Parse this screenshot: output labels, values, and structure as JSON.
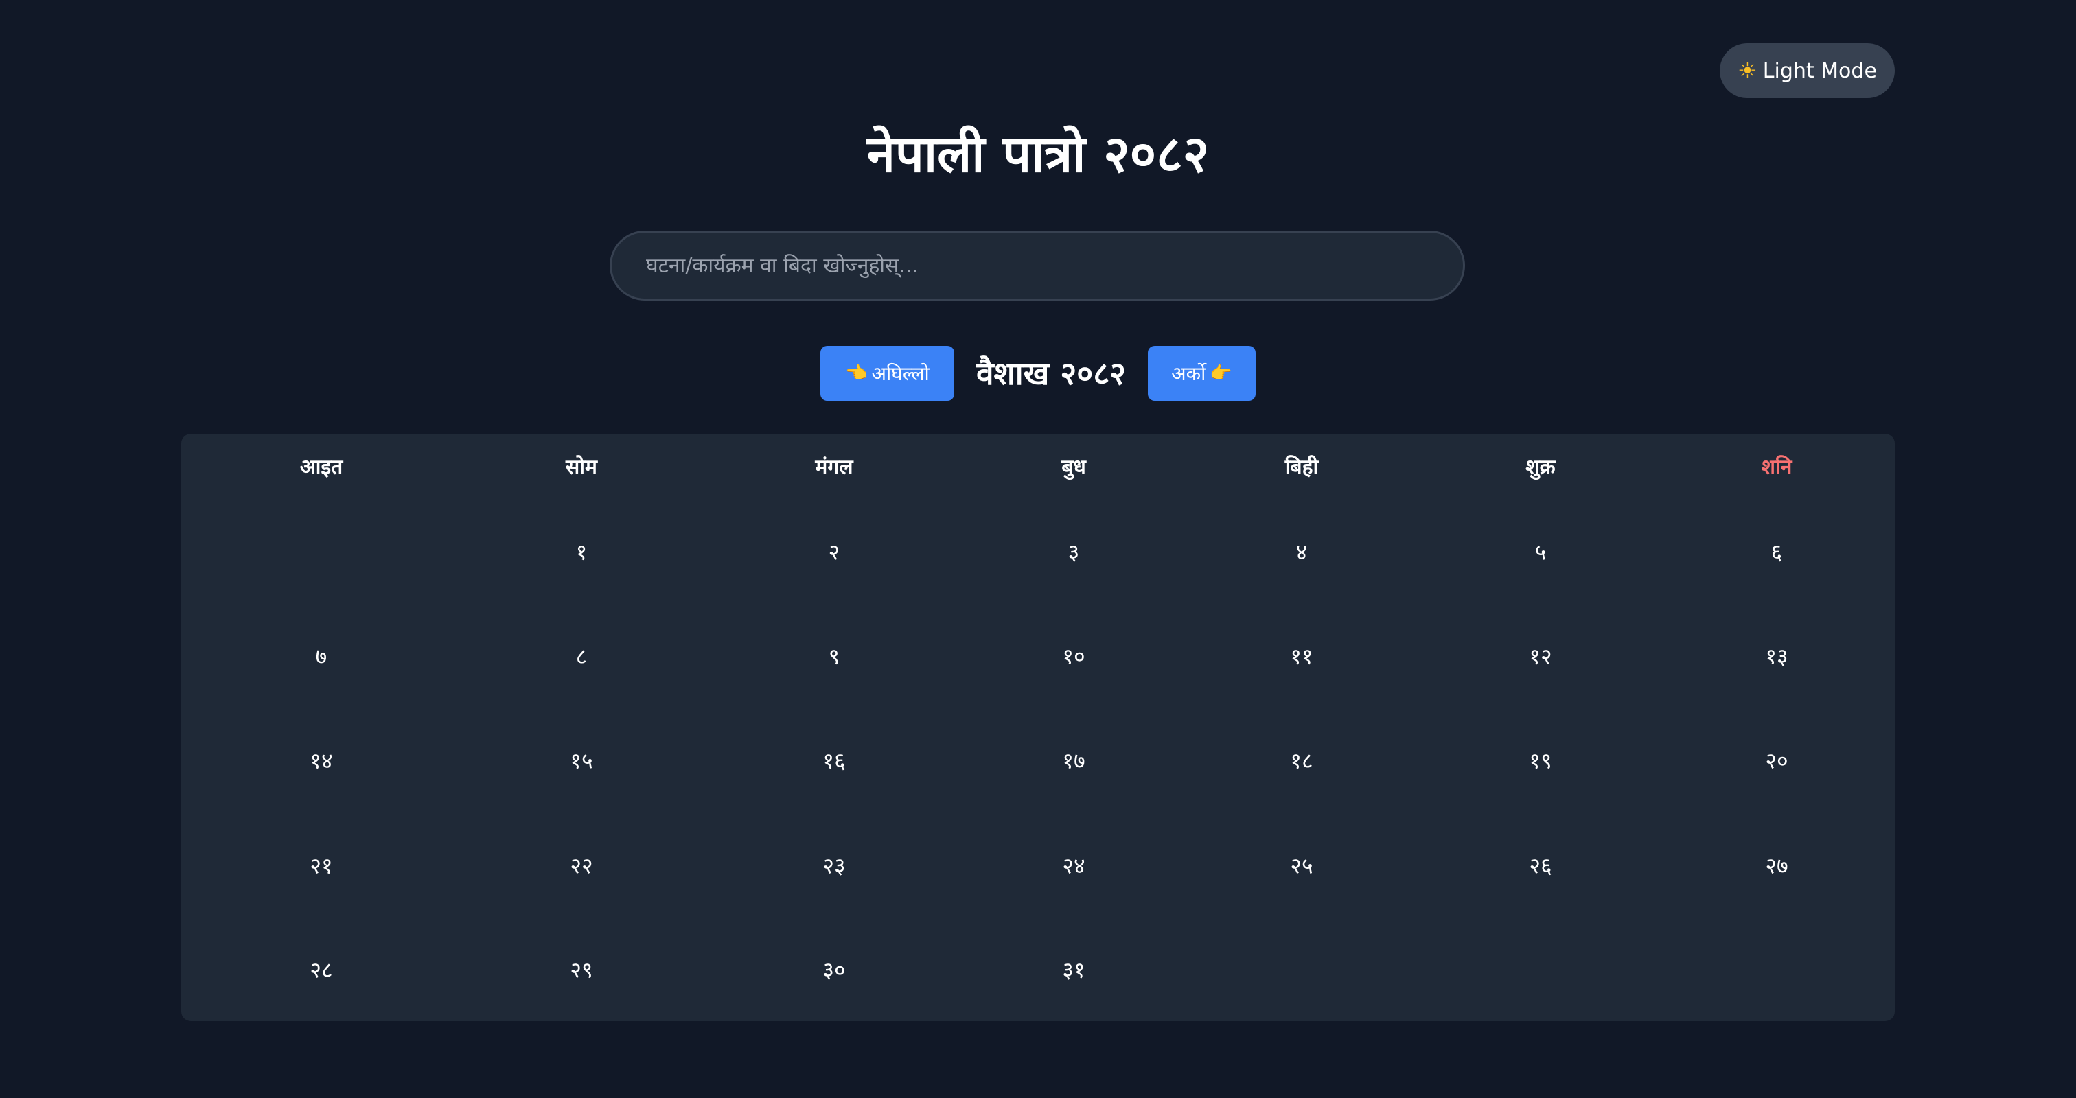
{
  "theme_toggle": {
    "icon": "sun-icon",
    "label": "Light Mode"
  },
  "title": "नेपाली पात्रो २०८२",
  "search": {
    "placeholder": "घटना/कार्यक्रम वा बिदा खोज्नुहोस्...",
    "value": ""
  },
  "navigation": {
    "prev_label": "अघिल्लो",
    "next_label": "अर्को",
    "prev_icon": "left-pointing-hand-icon",
    "next_icon": "right-pointing-hand-icon",
    "month_label": "वैशाख २०८२"
  },
  "calendar": {
    "weekdays": [
      "आइत",
      "सोम",
      "मंगल",
      "बुध",
      "बिही",
      "शुक्र",
      "शनि"
    ],
    "weeks": [
      [
        "",
        "१",
        "२",
        "३",
        "४",
        "५",
        "६"
      ],
      [
        "७",
        "८",
        "९",
        "१०",
        "११",
        "१२",
        "१३"
      ],
      [
        "१४",
        "१५",
        "१६",
        "१७",
        "१८",
        "१९",
        "२०"
      ],
      [
        "२१",
        "२२",
        "२३",
        "२४",
        "२५",
        "२६",
        "२७"
      ],
      [
        "२८",
        "२९",
        "३०",
        "३१",
        "",
        "",
        ""
      ]
    ]
  },
  "colors": {
    "background": "#111827",
    "panel": "#1f2937",
    "accent": "#3b82f6",
    "saturday": "#f87171"
  }
}
